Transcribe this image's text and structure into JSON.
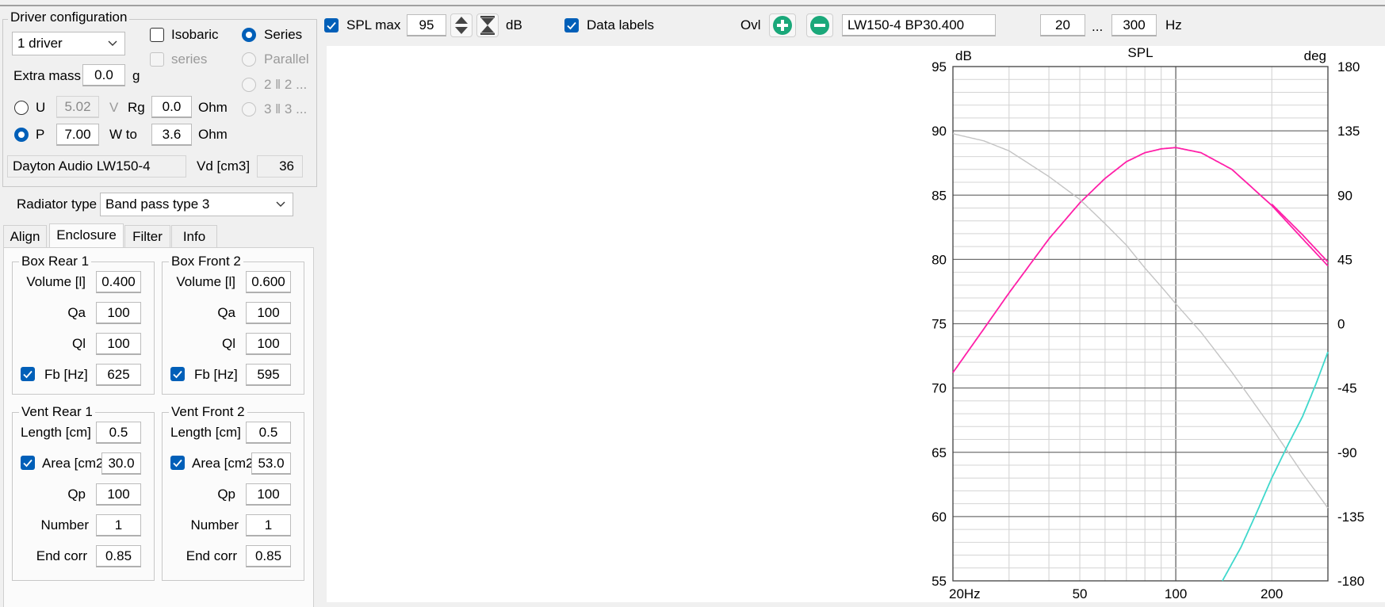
{
  "driver_config": {
    "group_title": "Driver configuration",
    "driver_count": "1 driver",
    "isobaric_label": "Isobaric",
    "series_sub_label": "series",
    "series_label": "Series",
    "parallel_label": "Parallel",
    "two_two_label": "2 ‖ 2 ...",
    "three_three_label": "3 ‖ 3 ...",
    "extra_mass_label": "Extra mass",
    "extra_mass_value": "0.0",
    "extra_mass_unit": "g",
    "u_label": "U",
    "u_value": "5.02",
    "u_unit": "V",
    "rg_label": "Rg",
    "rg_value": "0.0",
    "rg_unit": "Ohm",
    "p_label": "P",
    "p_value": "7.00",
    "w_to_label": "W to",
    "w_to_value": "3.6",
    "w_to_unit": "Ohm",
    "driver_name": "Dayton Audio LW150-4",
    "vd_label": "Vd [cm3]",
    "vd_value": "36"
  },
  "radiator": {
    "label": "Radiator type",
    "value": "Band pass type 3"
  },
  "tabs": [
    {
      "label": "Align"
    },
    {
      "label": "Enclosure"
    },
    {
      "label": "Filter"
    },
    {
      "label": "Info"
    }
  ],
  "box_rear": {
    "title": "Box Rear 1",
    "volume_label": "Volume [l]",
    "volume": "0.400",
    "qa_label": "Qa",
    "qa": "100",
    "ql_label": "Ql",
    "ql": "100",
    "fb_label": "Fb [Hz]",
    "fb": "625"
  },
  "box_front": {
    "title": "Box Front 2",
    "volume_label": "Volume [l]",
    "volume": "0.600",
    "qa_label": "Qa",
    "qa": "100",
    "ql_label": "Ql",
    "ql": "100",
    "fb_label": "Fb [Hz]",
    "fb": "595"
  },
  "vent_rear": {
    "title": "Vent Rear 1",
    "length_label": "Length [cm]",
    "length": "0.5",
    "area_label": "Area [cm2",
    "area": "30.0",
    "qp_label": "Qp",
    "qp": "100",
    "number_label": "Number",
    "number": "1",
    "endcorr_label": "End corr",
    "endcorr": "0.85"
  },
  "vent_front": {
    "title": "Vent Front 2",
    "length_label": "Length [cm]",
    "length": "0.5",
    "area_label": "Area [cm2",
    "area": "53.0",
    "qp_label": "Qp",
    "qp": "100",
    "number_label": "Number",
    "number": "1",
    "endcorr_label": "End corr",
    "endcorr": "0.85"
  },
  "toolbar": {
    "spl_max_label": "SPL max",
    "spl_max_value": "95",
    "db_unit": "dB",
    "data_labels_label": "Data labels",
    "ovl_label": "Ovl",
    "plus_icon": "plus-circle-icon",
    "minus_icon": "minus-circle-icon",
    "overlay_name": "LW150-4 BP30.400",
    "freq_min": "20",
    "ellipsis": "...",
    "freq_max": "300",
    "hz_unit": "Hz"
  },
  "colors": {
    "spl": "#ff1fa8",
    "phase": "#c4c4c4",
    "cyan": "#3fd8cc",
    "accent": "#005fb8",
    "green_button": "#1aa87a"
  },
  "chart_data": {
    "type": "line",
    "title": "SPL",
    "ylabel_left": "dB",
    "ylabel_right": "deg",
    "x_scale": "log",
    "xlim": [
      20,
      300
    ],
    "ylim": [
      55,
      95
    ],
    "ylim_right": [
      -180,
      180
    ],
    "x_tick_labels": [
      "20Hz",
      "50",
      "100",
      "200"
    ],
    "x_ticks": [
      20,
      50,
      100,
      200
    ],
    "y_ticks": [
      55,
      60,
      65,
      70,
      75,
      80,
      85,
      90,
      95
    ],
    "y_ticks_right": [
      -180,
      -135,
      -90,
      -45,
      0,
      45,
      90,
      135,
      180
    ],
    "grid": true,
    "series": [
      {
        "color": "#ff1fa8",
        "axis": "left",
        "x": [
          20,
          25,
          30,
          40,
          50,
          60,
          70,
          80,
          90,
          100,
          120,
          150,
          200,
          250,
          300
        ],
        "y": [
          71.2,
          74.6,
          77.4,
          81.6,
          84.4,
          86.3,
          87.6,
          88.3,
          88.6,
          88.7,
          88.3,
          87.0,
          84.2,
          81.6,
          79.5
        ]
      },
      {
        "color": "#ff1fa8",
        "axis": "left",
        "x": [
          200,
          250,
          300
        ],
        "y": [
          84.3,
          81.9,
          79.8
        ]
      },
      {
        "color": "#c4c4c4",
        "axis": "right",
        "x": [
          20,
          25,
          30,
          40,
          50,
          60,
          70,
          80,
          90,
          100,
          120,
          150,
          200,
          250,
          300
        ],
        "y": [
          133,
          128,
          121,
          103,
          87,
          70,
          55,
          39,
          26,
          14,
          -6,
          -34,
          -73,
          -105,
          -129
        ]
      },
      {
        "color": "#3fd8cc",
        "axis": "left",
        "x": [
          140,
          160,
          180,
          200,
          225,
          250,
          275,
          300
        ],
        "y": [
          55.0,
          57.6,
          60.4,
          63.0,
          65.6,
          67.8,
          70.3,
          72.8
        ]
      }
    ]
  }
}
